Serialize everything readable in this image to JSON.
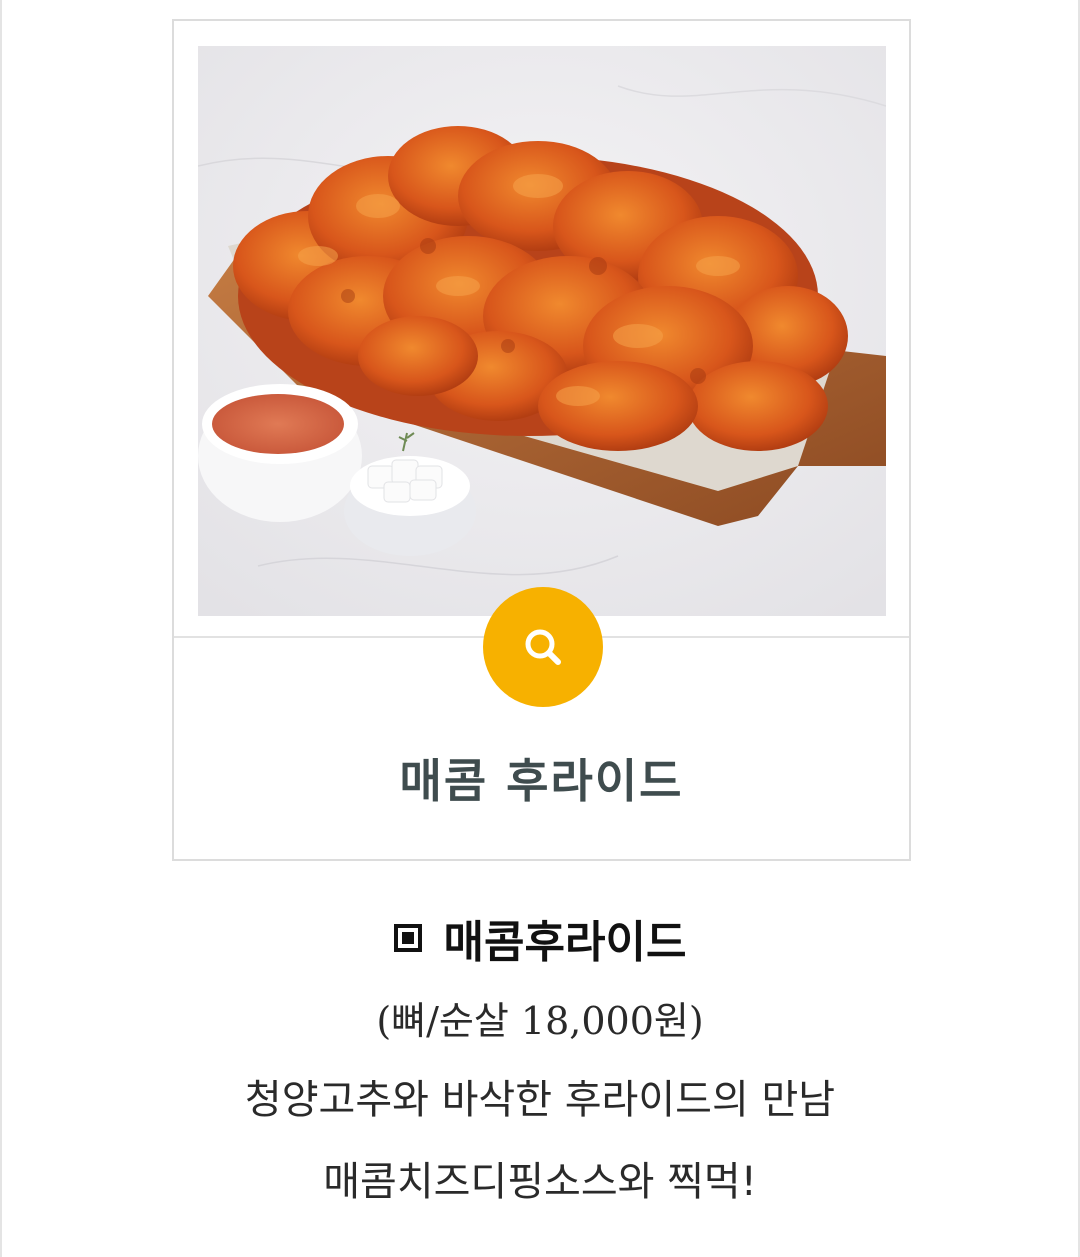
{
  "card": {
    "photo_alt": "매콤 후라이드",
    "zoom_icon": "search-icon",
    "title": "매콤 후라이드"
  },
  "product": {
    "heading_icon": "square-icon",
    "name": "매콤후라이드",
    "price": "(뼈/순살 18,000원)",
    "description_line1": "청양고추와 바삭한 후라이드의 만남",
    "description_line2": "매콤치즈디핑소스와 찍먹!"
  },
  "colors": {
    "zoom_button": "#f7b100",
    "card_title": "#3f4c4e",
    "card_border": "#dcdcdc"
  }
}
